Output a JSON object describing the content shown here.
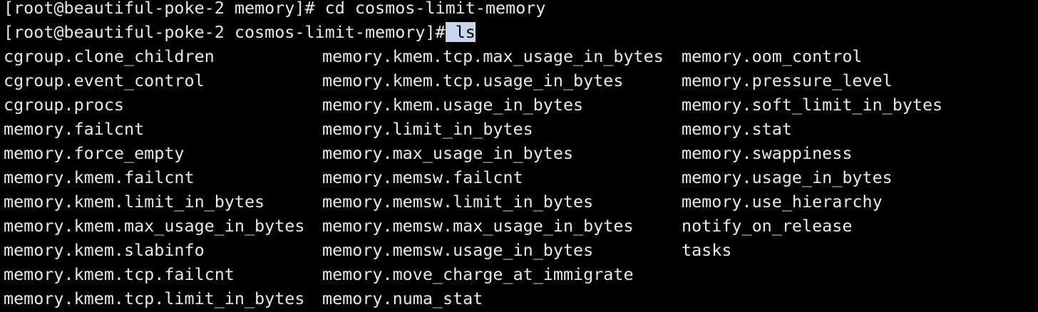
{
  "terminal": {
    "history": [
      {
        "prompt": "[root@beautiful-poke-2 memory]# ",
        "command": "cd cosmos-limit-memory"
      }
    ],
    "current": {
      "prompt": "[root@beautiful-poke-2 cosmos-limit-memory]#",
      "selected": " ls"
    },
    "selection_color": "#c6d6ee",
    "background": "#000000",
    "foreground": "#e8e8e8",
    "listing": {
      "columns": [
        [
          "cgroup.clone_children",
          "cgroup.event_control",
          "cgroup.procs",
          "memory.failcnt",
          "memory.force_empty",
          "memory.kmem.failcnt",
          "memory.kmem.limit_in_bytes",
          "memory.kmem.max_usage_in_bytes",
          "memory.kmem.slabinfo",
          "memory.kmem.tcp.failcnt",
          "memory.kmem.tcp.limit_in_bytes"
        ],
        [
          "memory.kmem.tcp.max_usage_in_bytes",
          "memory.kmem.tcp.usage_in_bytes",
          "memory.kmem.usage_in_bytes",
          "memory.limit_in_bytes",
          "memory.max_usage_in_bytes",
          "memory.memsw.failcnt",
          "memory.memsw.limit_in_bytes",
          "memory.memsw.max_usage_in_bytes",
          "memory.memsw.usage_in_bytes",
          "memory.move_charge_at_immigrate",
          "memory.numa_stat"
        ],
        [
          "memory.oom_control",
          "memory.pressure_level",
          "memory.soft_limit_in_bytes",
          "memory.stat",
          "memory.swappiness",
          "memory.usage_in_bytes",
          "memory.use_hierarchy",
          "notify_on_release",
          "tasks"
        ]
      ]
    }
  }
}
